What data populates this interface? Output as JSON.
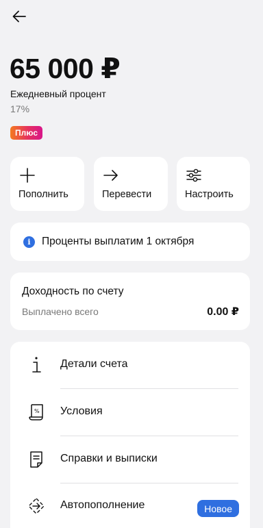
{
  "header": {
    "back_icon": "arrow-left-icon"
  },
  "account": {
    "balance": "65 000 ₽",
    "rate_label": "Ежедневный процент",
    "rate_value": "17%",
    "badge": "Плюс"
  },
  "actions": [
    {
      "label": "Пополнить",
      "icon": "plus-icon"
    },
    {
      "label": "Перевести",
      "icon": "arrow-right-icon"
    },
    {
      "label": "Настроить",
      "icon": "sliders-icon"
    }
  ],
  "info": {
    "icon": "info-icon",
    "text": "Проценты выплатим 1 октября"
  },
  "yield": {
    "title": "Доходность по счету",
    "paid_label": "Выплачено всего",
    "paid_value": "0.00 ₽"
  },
  "menu": [
    {
      "label": "Детали счета",
      "icon": "info-letter-icon"
    },
    {
      "label": "Условия",
      "icon": "percent-document-icon"
    },
    {
      "label": "Справки и выписки",
      "icon": "document-icon"
    },
    {
      "label": "Автопополнение",
      "icon": "auto-refill-icon",
      "badge": "Новое"
    }
  ],
  "colors": {
    "background": "#f2f2f4",
    "card": "#ffffff",
    "accent_blue": "#2f6fe0",
    "badge_gradient_start": "#f47a1f",
    "badge_gradient_end": "#d8168a"
  }
}
